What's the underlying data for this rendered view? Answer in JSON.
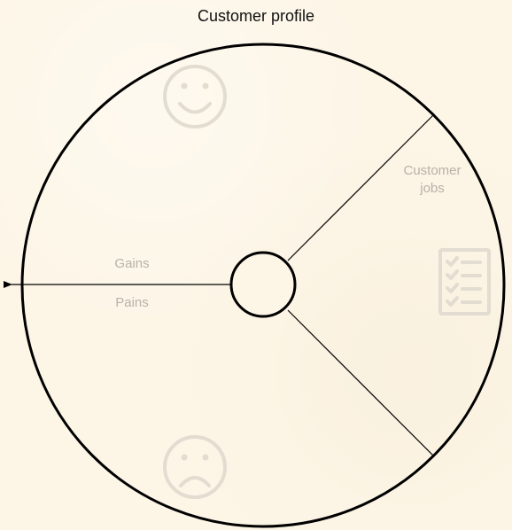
{
  "title": "Customer profile",
  "sections": {
    "jobs": {
      "line1": "Customer",
      "line2": "jobs",
      "icon": "checklist-icon"
    },
    "gains": {
      "label": "Gains",
      "icon": "happy-face-icon"
    },
    "pains": {
      "label": "Pains",
      "icon": "sad-face-icon"
    }
  },
  "colors": {
    "background": "#fdf6e7",
    "stroke": "#000000",
    "label": "#b7b1a8",
    "icon": "#e2dcd1"
  }
}
